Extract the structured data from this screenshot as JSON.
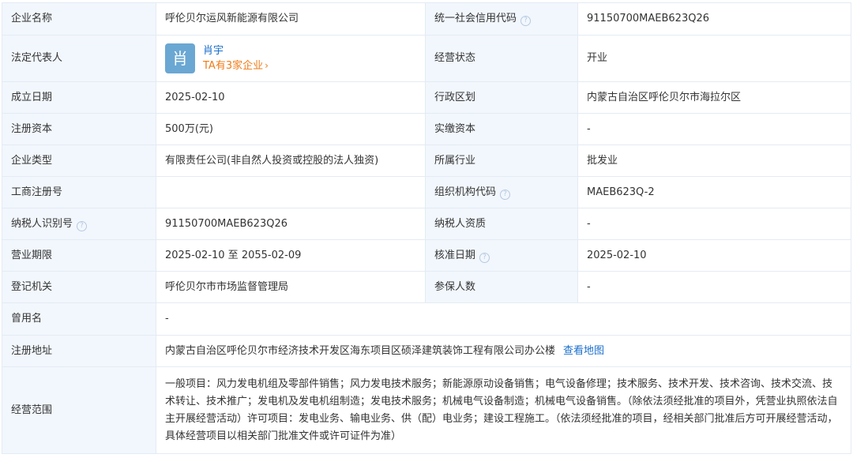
{
  "rows": {
    "company_name": {
      "label": "企业名称",
      "value": "呼伦贝尔运风新能源有限公司"
    },
    "credit_code": {
      "label": "统一社会信用代码",
      "value": "91150700MAEB623Q26"
    },
    "legal_rep": {
      "label": "法定代表人",
      "avatar_char": "肖",
      "name": "肖宇",
      "companies_link": "TA有3家企业"
    },
    "status": {
      "label": "经营状态",
      "value": "开业"
    },
    "established": {
      "label": "成立日期",
      "value": "2025-02-10"
    },
    "region": {
      "label": "行政区划",
      "value": "内蒙古自治区呼伦贝尔市海拉尔区"
    },
    "reg_capital": {
      "label": "注册资本",
      "value": "500万(元)"
    },
    "paid_capital": {
      "label": "实缴资本",
      "value": "-"
    },
    "company_type": {
      "label": "企业类型",
      "value": "有限责任公司(非自然人投资或控股的法人独资)"
    },
    "industry": {
      "label": "所属行业",
      "value": "批发业"
    },
    "biz_reg_no": {
      "label": "工商注册号",
      "value": ""
    },
    "org_code": {
      "label": "组织机构代码",
      "value": "MAEB623Q-2"
    },
    "taxpayer_id": {
      "label": "纳税人识别号",
      "value": "91150700MAEB623Q26"
    },
    "taxpayer_qual": {
      "label": "纳税人资质",
      "value": "-"
    },
    "term": {
      "label": "营业期限",
      "value": "2025-02-10 至 2055-02-09"
    },
    "approval_date": {
      "label": "核准日期",
      "value": "2025-02-10"
    },
    "authority": {
      "label": "登记机关",
      "value": "呼伦贝尔市市场监督管理局"
    },
    "insured": {
      "label": "参保人数",
      "value": "-"
    },
    "former_name": {
      "label": "曾用名",
      "value": "-"
    },
    "address": {
      "label": "注册地址",
      "value": "内蒙古自治区呼伦贝尔市经济技术开发区海东项目区硕泽建筑装饰工程有限公司办公楼",
      "map_link": "查看地图"
    },
    "scope": {
      "label": "经营范围",
      "value": "一般项目：风力发电机组及零部件销售；风力发电技术服务；新能源原动设备销售；电气设备修理；技术服务、技术开发、技术咨询、技术交流、技术转让、技术推广；发电机及发电机组制造；发电技术服务；机械电气设备制造；机械电气设备销售。（除依法须经批准的项目外，凭营业执照依法自主开展经营活动）许可项目：发电业务、输电业务、供（配）电业务；建设工程施工。（依法须经批准的项目，经相关部门批准后方可开展经营活动，具体经营项目以相关部门批准文件或许可证件为准）"
    }
  },
  "icons": {
    "help": "question-circle-icon",
    "chevron": "chevron-right-icon"
  },
  "colors": {
    "label_bg": "#f2f7fd",
    "border": "#e4ebf3",
    "link_blue": "#1a6fcc",
    "link_orange": "#f07b17",
    "avatar_bg": "#6aa7d3"
  }
}
